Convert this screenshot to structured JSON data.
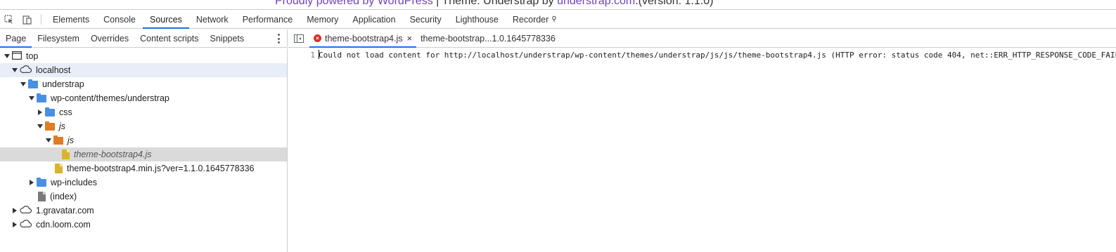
{
  "page_strip": {
    "prefix": "Proudly powered by WordPress",
    "middle": " | Theme: Understrap by ",
    "link": "understrap.com",
    "suffix": ".(version: 1.1.0)"
  },
  "main_tabs": [
    {
      "label": "Elements"
    },
    {
      "label": "Console"
    },
    {
      "label": "Sources"
    },
    {
      "label": "Network"
    },
    {
      "label": "Performance"
    },
    {
      "label": "Memory"
    },
    {
      "label": "Application"
    },
    {
      "label": "Security"
    },
    {
      "label": "Lighthouse"
    },
    {
      "label": "Recorder"
    }
  ],
  "navigator_tabs": [
    {
      "label": "Page"
    },
    {
      "label": "Filesystem"
    },
    {
      "label": "Overrides"
    },
    {
      "label": "Content scripts"
    },
    {
      "label": "Snippets"
    }
  ],
  "tree": [
    {
      "label": "top"
    },
    {
      "label": "localhost"
    },
    {
      "label": "understrap"
    },
    {
      "label": "wp-content/themes/understrap"
    },
    {
      "label": "css"
    },
    {
      "label": "js"
    },
    {
      "label": "js"
    },
    {
      "label": "theme-bootstrap4.js"
    },
    {
      "label": "theme-bootstrap4.min.js?ver=1.1.0.1645778336"
    },
    {
      "label": "wp-includes"
    },
    {
      "label": "(index)"
    },
    {
      "label": "1.gravatar.com"
    },
    {
      "label": "cdn.loom.com"
    }
  ],
  "editor_tabs": [
    {
      "label": "theme-bootstrap4.js"
    },
    {
      "label": "theme-bootstrap...1.0.1645778336"
    }
  ],
  "editor": {
    "line_number": "1",
    "content": "Could not load content for http://localhost/understrap/wp-content/themes/understrap/js/js/theme-bootstrap4.js (HTTP error: status code 404, net::ERR_HTTP_RESPONSE_CODE_FAILURE)"
  },
  "colors": {
    "accent": "#1a73e8",
    "folder_blue": "#4a90e2",
    "folder_orange": "#e07c24",
    "file_yellow": "#d9b42c",
    "error": "#d93025"
  }
}
